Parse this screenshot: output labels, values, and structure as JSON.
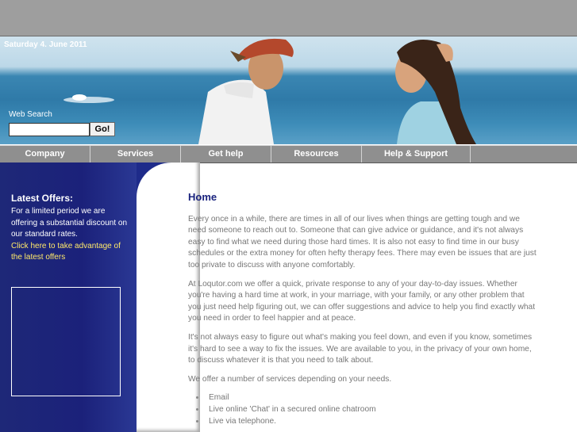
{
  "header": {
    "date": "Saturday 4. June 2011"
  },
  "search": {
    "label": "Web Search",
    "value": "",
    "button": "Go!"
  },
  "nav": [
    "Company",
    "Services",
    "Get help",
    "Resources",
    "Help & Support"
  ],
  "sidebar": {
    "title": "Latest Offers:",
    "text": "For a limited period we are offering a substantial discount on our standard rates.",
    "link": "Click here to take advantage of the latest offers"
  },
  "main": {
    "title": "Home",
    "paragraphs": [
      "Every once in a while, there are times in all of our lives when things are getting tough and we need someone to reach out to. Someone that can give advice or guidance, and it's not always easy to find what we need during those hard times. It is also not easy to find time in our busy schedules or the extra money for often hefty therapy fees. There may even be issues that are just too private to discuss with anyone comfortably.",
      "At Loqutor.com we offer a quick, private response to any of your day-to-day issues. Whether you're having a hard time at work, in your marriage, with your family, or any other problem that you just need help figuring out, we can offer suggestions and advice to help you find exactly what you need in order to feel happier and at peace.",
      "It's not always easy to figure out what's making you feel down, and even if you know, sometimes it's hard to see a way to fix the issues. We are available to you, in the privacy of your own home, to discuss whatever it is that you need to talk about.",
      "We offer a number of services depending on your needs."
    ],
    "services": [
      "Email",
      "Live online 'Chat' in a secured online chatroom",
      "Live via telephone."
    ]
  }
}
